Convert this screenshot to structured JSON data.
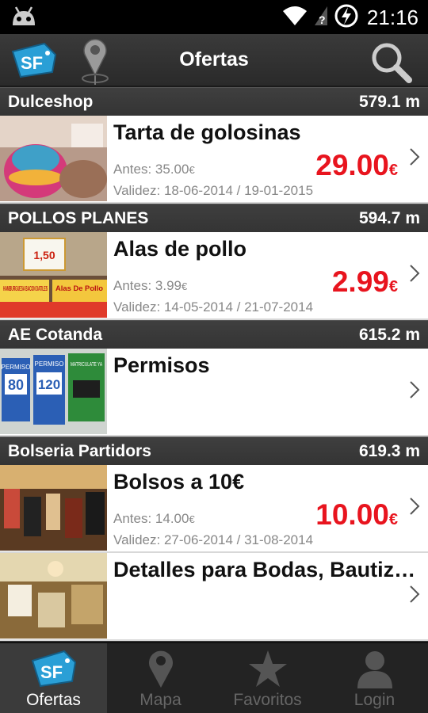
{
  "status": {
    "time": "21:16"
  },
  "header": {
    "title": "Ofertas"
  },
  "colors": {
    "price": "#e8141e",
    "accent": "#2a9fd6"
  },
  "shops": [
    {
      "name": "Dulceshop",
      "distance": "579.1 m",
      "offers": [
        {
          "title": "Tarta de golosinas",
          "before": "Antes: 35.00",
          "before_currency": "€",
          "price": "29.00",
          "currency": "€",
          "validity": "Validez: 18-06-2014 / 19-01-2015"
        }
      ]
    },
    {
      "name": "POLLOS PLANES",
      "distance": "594.7 m",
      "offers": [
        {
          "title": "Alas de pollo",
          "before": "Antes: 3.99",
          "before_currency": "€",
          "price": "2.99",
          "currency": "€",
          "validity": "Validez: 14-05-2014 / 21-07-2014"
        }
      ]
    },
    {
      "name": "AE Cotanda",
      "distance": "615.2 m",
      "offers": [
        {
          "title": "Permisos"
        }
      ]
    },
    {
      "name": "Bolseria Partidors",
      "distance": "619.3 m",
      "offers": [
        {
          "title": "Bolsos a 10€",
          "before": "Antes: 14.00",
          "before_currency": "€",
          "price": "10.00",
          "currency": "€",
          "validity": "Validez: 27-06-2014 / 31-08-2014"
        },
        {
          "title": "Detalles para Bodas, Bautizos y Comuniones"
        }
      ]
    }
  ],
  "thumb_text": {
    "pollo_price": "1,50",
    "pollo_sign1": "HAMBURGUESA BACON DATILES",
    "pollo_sign2": "Alas De Pollo",
    "permiso1": "PERMISO",
    "permiso1_value": "80",
    "permiso2": "PERMISO",
    "permiso2_value": "120",
    "permiso3": "MATRICULATE YA"
  },
  "logo": {
    "text": "SF"
  },
  "tabs": [
    {
      "label": "Ofertas",
      "icon": "sf-tag-icon",
      "active": true
    },
    {
      "label": "Mapa",
      "icon": "map-pin-icon",
      "active": false
    },
    {
      "label": "Favoritos",
      "icon": "star-icon",
      "active": false
    },
    {
      "label": "Login",
      "icon": "user-icon",
      "active": false
    }
  ]
}
